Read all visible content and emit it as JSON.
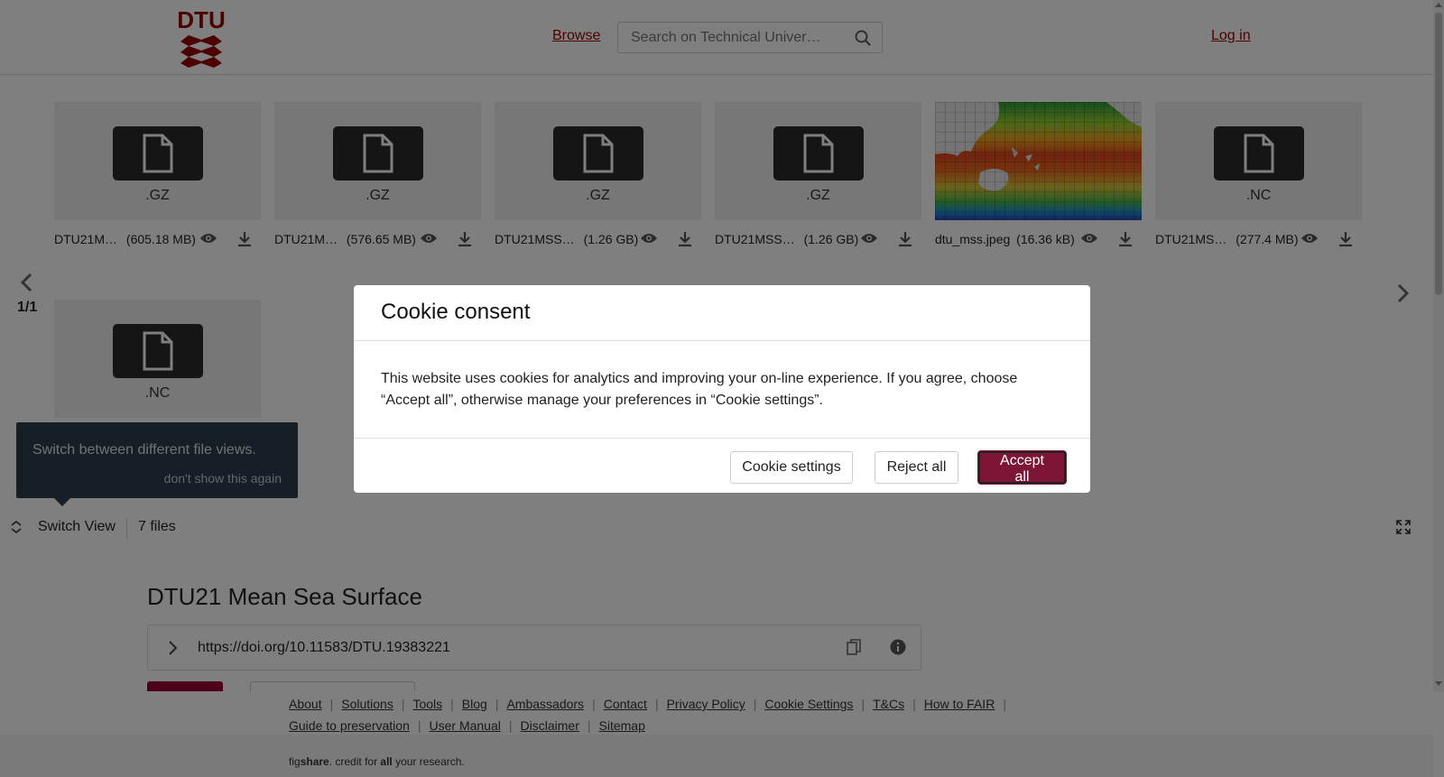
{
  "header": {
    "logo_text": "DTU",
    "browse_label": "Browse",
    "search_placeholder": "Search on Technical Univer…",
    "login_label": "Log in"
  },
  "files": [
    {
      "type": "doc",
      "ext": ".GZ",
      "name": "DTU21M…",
      "size": "(605.18 MB)"
    },
    {
      "type": "doc",
      "ext": ".GZ",
      "name": "DTU21M…",
      "size": "(576.65 MB)"
    },
    {
      "type": "doc",
      "ext": ".GZ",
      "name": "DTU21MSS…",
      "size": "(1.26 GB)"
    },
    {
      "type": "doc",
      "ext": ".GZ",
      "name": "DTU21MSS…",
      "size": "(1.26 GB)"
    },
    {
      "type": "image",
      "ext": "",
      "name": "dtu_mss.jpeg",
      "size": "(16.36 kB)"
    },
    {
      "type": "doc",
      "ext": ".NC",
      "name": "DTU21MS…",
      "size": "(277.4 MB)"
    },
    {
      "type": "doc",
      "ext": ".NC",
      "name": "",
      "size": ""
    }
  ],
  "pager": "1/1",
  "tooltip": {
    "text": "Switch between different file views.",
    "dismiss": "don't show this again"
  },
  "switch_view": {
    "label": "Switch View",
    "count": "7 files"
  },
  "item": {
    "title": "DTU21 Mean Sea Surface",
    "doi": "https://doi.org/10.11583/DTU.19383221"
  },
  "footer": {
    "row1": [
      "About",
      "Solutions",
      "Tools",
      "Blog",
      "Ambassadors",
      "Contact",
      "Privacy Policy",
      "Cookie Settings",
      "T&Cs",
      "How to FAIR"
    ],
    "row2": [
      "Guide to preservation",
      "User Manual",
      "Disclaimer",
      "Sitemap"
    ],
    "credit_parts": [
      "fig",
      "share",
      ". credit for ",
      "all",
      " your research."
    ]
  },
  "cookie": {
    "title": "Cookie consent",
    "body": "This website uses cookies for analytics and improving your on-line experience. If you agree, choose “Accept all”, otherwise manage your preferences in “Cookie settings”.",
    "settings_label": "Cookie settings",
    "reject_label": "Reject all",
    "accept_label": "Accept all"
  },
  "colors": {
    "brand": "#990000",
    "accept": "#7d1535",
    "tooltip_bg": "#2e3f4c"
  }
}
